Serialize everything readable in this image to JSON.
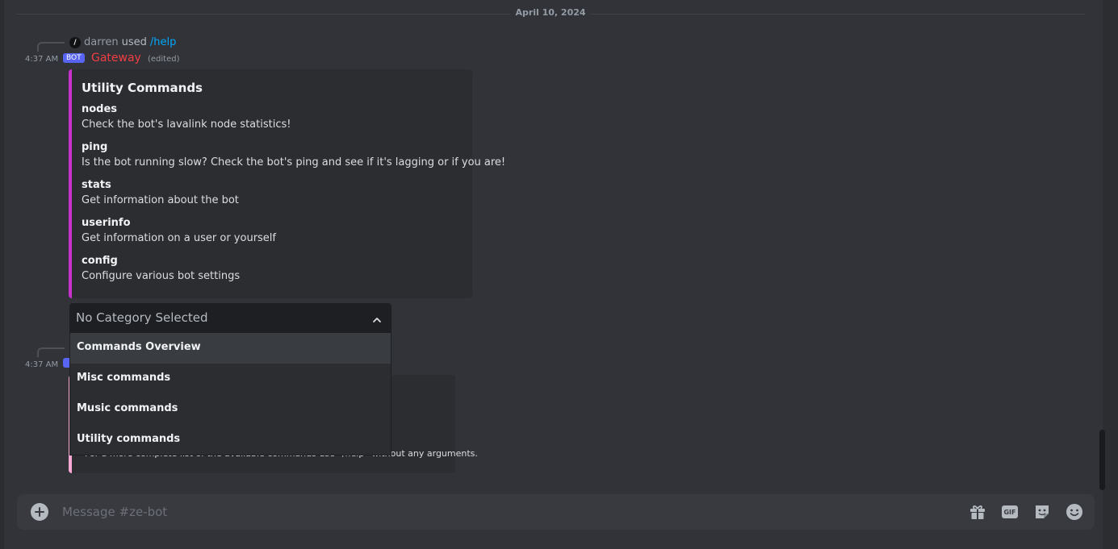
{
  "date_divider": "April 10, 2024",
  "message1": {
    "command_user": "darren",
    "command_used_word": "used",
    "command_name": "/help",
    "timestamp": "4:37 AM",
    "bot_badge": "BOT",
    "author": "Gateway",
    "edited": "(edited)"
  },
  "embed": {
    "accent_color": "#c930cc",
    "title": "Utility Commands",
    "fields": [
      {
        "name": "nodes",
        "value": "Check the bot's lavalink node statistics!"
      },
      {
        "name": "ping",
        "value": "Is the bot running slow? Check the bot's ping and see if it's lagging or if you are!"
      },
      {
        "name": "stats",
        "value": "Get information about the bot"
      },
      {
        "name": "userinfo",
        "value": "Get information on a user or yourself"
      },
      {
        "name": "config",
        "value": "Configure various bot settings"
      }
    ]
  },
  "select_menu": {
    "placeholder": "No Category Selected",
    "options": [
      "Commands Overview",
      "Misc commands",
      "Music commands",
      "Utility commands"
    ],
    "highlighted": "Commands Overview"
  },
  "message2": {
    "timestamp": "4:37 AM",
    "embed_accent_color": "#f9a8d4",
    "footer": "For a more complete list of the available commands use `/help` without any arguments."
  },
  "composer": {
    "placeholder": "Message #ze-bot"
  },
  "icons": {
    "composer_add": "plus-circle-icon",
    "gift": "gift-icon",
    "gif_label": "GIF",
    "sticker": "sticker-icon",
    "emoji": "emoji-icon"
  },
  "colors": {
    "background": "#313338",
    "embed_background": "#2b2d31",
    "author": "#f23f43",
    "link": "#00a8fc",
    "bot_badge": "#5865f2"
  }
}
